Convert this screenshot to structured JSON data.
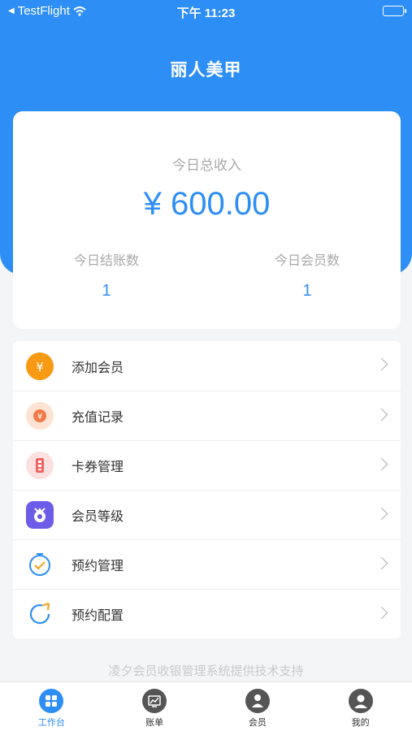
{
  "status_bar": {
    "carrier": "TestFlight",
    "time": "下午 11:23"
  },
  "header": {
    "title": "丽人美甲"
  },
  "summary": {
    "income_label": "今日总收入",
    "income_amount": "¥ 600.00",
    "checkouts_label": "今日结账数",
    "checkouts_value": "1",
    "members_label": "今日会员数",
    "members_value": "1"
  },
  "menu": {
    "items": [
      {
        "label": "添加会员",
        "icon": "yen-coin-icon"
      },
      {
        "label": "充值记录",
        "icon": "recharge-icon"
      },
      {
        "label": "卡券管理",
        "icon": "coupon-icon"
      },
      {
        "label": "会员等级",
        "icon": "member-level-icon"
      },
      {
        "label": "预约管理",
        "icon": "alarm-clock-icon"
      },
      {
        "label": "预约配置",
        "icon": "refresh-arrow-icon"
      }
    ]
  },
  "footer": {
    "credit": "凌夕会员收银管理系统提供技术支持"
  },
  "tabbar": {
    "tabs": [
      {
        "label": "工作台",
        "icon": "grid-icon",
        "active": true
      },
      {
        "label": "账单",
        "icon": "chart-icon",
        "active": false
      },
      {
        "label": "会员",
        "icon": "member-icon",
        "active": false
      },
      {
        "label": "我的",
        "icon": "profile-icon",
        "active": false
      }
    ]
  },
  "colors": {
    "primary": "#2d8ef5",
    "background": "#f4f5f7",
    "muted_text": "#a9a9a9"
  }
}
